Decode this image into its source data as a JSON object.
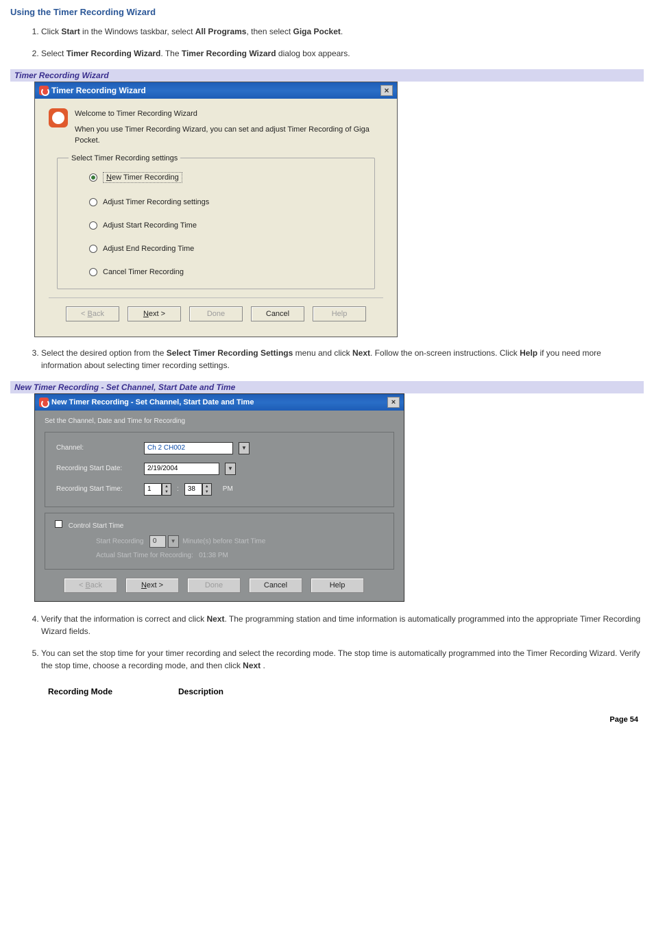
{
  "section_title": "Using the Timer Recording Wizard",
  "steps": {
    "s1_pre": "Click ",
    "s1_b1": "Start",
    "s1_mid1": " in the Windows taskbar, select ",
    "s1_b2": "All Programs",
    "s1_mid2": ", then select ",
    "s1_b3": "Giga Pocket",
    "s1_end": ".",
    "s2_pre": "Select ",
    "s2_b1": "Timer Recording Wizard",
    "s2_mid1": ". The ",
    "s2_b2": "Timer Recording Wizard",
    "s2_end": " dialog box appears.",
    "s3_pre": "Select the desired option from the ",
    "s3_b1": "Select Timer Recording Settings",
    "s3_mid1": " menu and click ",
    "s3_b2": "Next",
    "s3_mid2": ". Follow the on-screen instructions. Click ",
    "s3_b3": "Help",
    "s3_end": " if you need more information about selecting timer recording settings.",
    "s4_pre": "Verify that the information is correct and click ",
    "s4_b1": "Next",
    "s4_end": ". The programming station and time information is automatically programmed into the appropriate Timer Recording Wizard fields.",
    "s5_pre": "You can set the stop time for your timer recording and select the recording mode. The stop time is automatically programmed into the Timer Recording Wizard. Verify the stop time, choose a recording mode, and then click ",
    "s5_b1": "Next",
    "s5_end": " ."
  },
  "caption1": "Timer Recording Wizard",
  "dlg1": {
    "title": "Timer Recording Wizard",
    "close": "×",
    "welcome": "Welcome to Timer Recording Wizard",
    "desc": "When you use Timer Recording Wizard, you can set and adjust Timer Recording of Giga Pocket.",
    "group_title": "Select Timer Recording settings",
    "options": {
      "o1_acc": "N",
      "o1_rest": "ew Timer Recording",
      "o2": "Adjust Timer Recording settings",
      "o3": "Adjust Start Recording Time",
      "o4": "Adjust End Recording Time",
      "o5": "Cancel Timer Recording"
    },
    "buttons": {
      "back_lt": "< ",
      "back_acc": "B",
      "back_rest": "ack",
      "next_acc": "N",
      "next_rest": "ext >",
      "done": "Done",
      "cancel": "Cancel",
      "help": "Help"
    }
  },
  "caption2": "New Timer Recording - Set Channel, Start Date and Time",
  "dlg2": {
    "title": "New Timer Recording - Set Channel, Start Date and Time",
    "close": "×",
    "sub": "Set the Channel, Date and Time for Recording",
    "channel_label": "Channel:",
    "channel_value": "Ch 2 CH002",
    "date_label": "Recording Start Date:",
    "date_value": "2/19/2004",
    "time_label": "Recording Start Time:",
    "time_hour": "1",
    "time_sep": ":",
    "time_min": "38",
    "time_ampm": "PM",
    "control_label": "Control Start Time",
    "start_rec_label": "Start Recording",
    "start_rec_value": "0",
    "start_rec_suffix": "Minute(s) before Start Time",
    "actual_label": "Actual Start Time for Recording:",
    "actual_value": "01:38 PM",
    "buttons": {
      "back_lt": "< ",
      "back_acc": "B",
      "back_rest": "ack",
      "next_acc": "N",
      "next_rest": "ext >",
      "done": "Done",
      "cancel": "Cancel",
      "help": "Help"
    }
  },
  "table": {
    "col1": "Recording Mode",
    "col2": "Description"
  },
  "page": "Page 54"
}
